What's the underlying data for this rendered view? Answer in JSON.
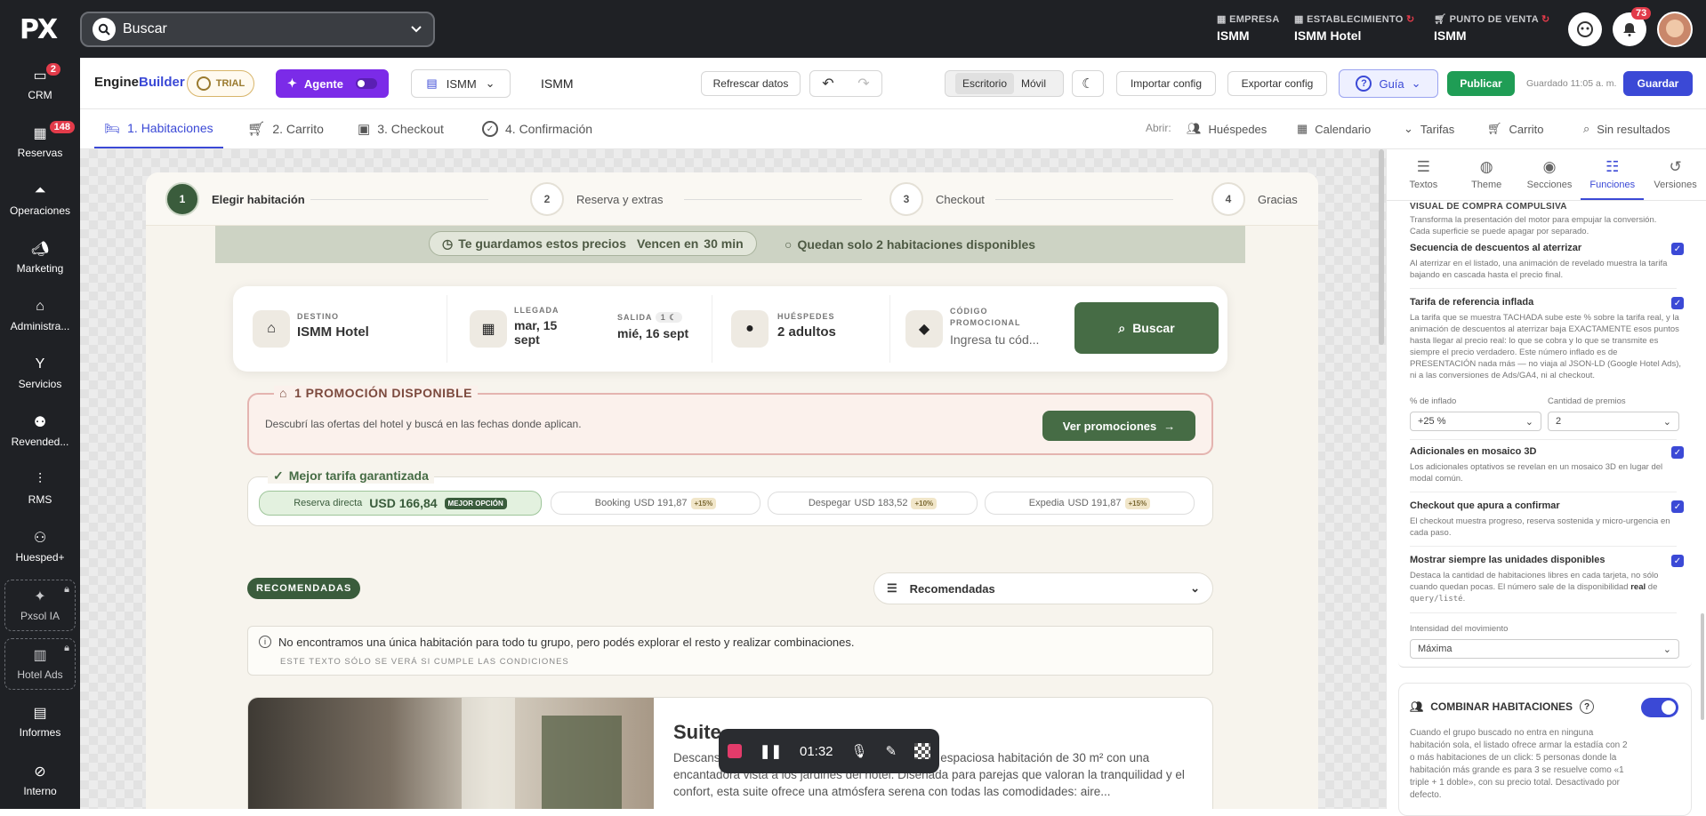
{
  "topbar": {
    "logo": "PX",
    "search_placeholder": "Buscar",
    "empresa_label": "EMPRESA",
    "empresa_value": "ISMM",
    "establecimiento_label": "ESTABLECIMIENTO",
    "establecimiento_value": "ISMM Hotel",
    "punto_venta_label": "PUNTO DE VENTA",
    "punto_venta_value": "ISMM",
    "notifications_count": "73"
  },
  "sidebar": {
    "items": [
      {
        "label": "CRM",
        "badge": "2",
        "icon": "chat-icon"
      },
      {
        "label": "Reservas",
        "badge": "148",
        "icon": "calendar-icon"
      },
      {
        "label": "Operaciones",
        "badge": "",
        "icon": "bell-icon"
      },
      {
        "label": "Marketing",
        "badge": "",
        "icon": "megaphone-icon"
      },
      {
        "label": "Administra...",
        "badge": "",
        "icon": "building-icon"
      },
      {
        "label": "Servicios",
        "badge": "",
        "icon": "cocktail-icon"
      },
      {
        "label": "Revended...",
        "badge": "",
        "icon": "people-icon"
      },
      {
        "label": "RMS",
        "badge": "",
        "icon": "chart-icon"
      },
      {
        "label": "Huesped+",
        "badge": "",
        "icon": "user-plus-icon"
      },
      {
        "label": "Pxsol IA",
        "badge": "",
        "icon": "sparkle-icon"
      },
      {
        "label": "Hotel Ads",
        "badge": "",
        "icon": "bar-chart-icon"
      },
      {
        "label": "Informes",
        "badge": "",
        "icon": "document-icon"
      },
      {
        "label": "Interno",
        "badge": "",
        "icon": "block-icon"
      }
    ]
  },
  "builder": {
    "brand_a": "Engine",
    "brand_b": "Builder",
    "trial": "TRIAL",
    "agent": "Agente",
    "property": "ISMM",
    "property_name": "ISMM",
    "refresh": "Refrescar datos",
    "view_desktop": "Escritorio",
    "view_mobile": "Móvil",
    "import": "Importar config",
    "export": "Exportar config",
    "guide": "Guía",
    "publish": "Publicar",
    "saved": "Guardado 11:05 a. m.",
    "save": "Guardar"
  },
  "tabs": [
    {
      "label": "1. Habitaciones"
    },
    {
      "label": "2. Carrito"
    },
    {
      "label": "3. Checkout"
    },
    {
      "label": "4. Confirmación"
    }
  ],
  "open_links": {
    "label": "Abrir:",
    "items": [
      "Huéspedes",
      "Calendario",
      "Tarifas",
      "Carrito",
      "Sin resultados"
    ]
  },
  "preview": {
    "steps": [
      {
        "num": "1",
        "label": "Elegir habitación"
      },
      {
        "num": "2",
        "label": "Reserva y extras"
      },
      {
        "num": "3",
        "label": "Checkout"
      },
      {
        "num": "4",
        "label": "Gracias"
      }
    ],
    "banner_a": "Te guardamos estos precios",
    "banner_b": "Vencen en",
    "banner_time": "30 min",
    "banner_c": "Quedan solo 2 habitaciones disponibles",
    "destino_label": "DESTINO",
    "destino_value": "ISMM Hotel",
    "llegada_label": "LLEGADA",
    "llegada_value": "mar, 15 sept",
    "salida_label": "SALIDA",
    "salida_nights": "1",
    "salida_value": "mié, 16 sept",
    "huespedes_label": "HUÉSPEDES",
    "huespedes_value": "2 adultos",
    "codigo_label": "CÓDIGO PROMOCIONAL",
    "codigo_placeholder": "Ingresa tu cód...",
    "search_btn": "Buscar",
    "promo_title": "1 PROMOCIÓN DISPONIBLE",
    "promo_desc": "Descubrí las ofertas del hotel y buscá en las fechas donde aplican.",
    "promo_btn": "Ver promociones",
    "best_rate_title": "Mejor tarifa garantizada",
    "direct_label": "Reserva directa",
    "direct_price": "USD 166,84",
    "direct_tag": "MEJOR OPCIÓN",
    "competitors": [
      {
        "name": "Booking",
        "price": "USD 191,87",
        "diff": "+15%"
      },
      {
        "name": "Despegar",
        "price": "USD 183,52",
        "diff": "+10%"
      },
      {
        "name": "Expedia",
        "price": "USD 191,87",
        "diff": "+15%"
      }
    ],
    "recommended_tag": "RECOMENDADAS",
    "sort_value": "Recomendadas",
    "notice_text": "No encontramos una única habitación para todo tu grupo, pero podés explorar el resto y realizar combinaciones.",
    "notice_sub": "ESTE TEXTO SÓLO SE VERÁ SI CUMPLE LAS CONDICIONES",
    "room_title": "Suite",
    "room_desc": "Descansa en nuestra elegante Suite Garden, una espaciosa habitación de 30 m² con una encantadora vista a los jardines del hotel. Diseñada para parejas que valoran la tranquilidad y el confort, esta suite ofrece una atmósfera serena con todas las comodidades: aire...",
    "recorder_time": "01:32"
  },
  "panel": {
    "tabs": [
      {
        "label": "Textos",
        "icon": "text-icon"
      },
      {
        "label": "Theme",
        "icon": "palette-icon"
      },
      {
        "label": "Secciones",
        "icon": "eye-icon"
      },
      {
        "label": "Funciones",
        "icon": "sliders-icon"
      },
      {
        "label": "Versiones",
        "icon": "history-icon"
      }
    ],
    "section_title": "VISUAL DE COMPRA COMPULSIVA",
    "section_desc": "Transforma la presentación del motor para empujar la conversión. Cada superficie se puede apagar por separado.",
    "options": [
      {
        "title": "Secuencia de descuentos al aterrizar",
        "desc": "Al aterrizar en el listado, una animación de revelado muestra la tarifa bajando en cascada hasta el precio final.",
        "checked": true
      },
      {
        "title": "Tarifa de referencia inflada",
        "desc": "La tarifa que se muestra TACHADA sube este % sobre la tarifa real, y la animación de descuentos al aterrizar baja EXACTAMENTE esos puntos hasta llegar al precio real: lo que se cobra y lo que se transmite es siempre el precio verdadero. Este número inflado es de PRESENTACIÓN nada más — no viaja al JSON-LD (Google Hotel Ads), ni a las conversiones de Ads/GA4, ni al checkout.",
        "checked": true
      },
      {
        "title": "Adicionales en mosaico 3D",
        "desc": "Los adicionales optativos se revelan en un mosaico 3D en lugar del modal común.",
        "checked": true
      },
      {
        "title": "Checkout que apura a confirmar",
        "desc": "El checkout muestra progreso, reserva sostenida y micro-urgencia en cada paso.",
        "checked": true
      },
      {
        "title": "Mostrar siempre las unidades disponibles",
        "desc_a": "Destaca la cantidad de habitaciones libres en cada tarjeta, no sólo cuando quedan pocas. El número sale de la disponibilidad",
        "desc_b": "real",
        "desc_c": "de",
        "desc_code": "query/listé",
        "desc_d": ".",
        "checked": true
      }
    ],
    "inflate_label": "% de inflado",
    "inflate_value": "+25 %",
    "prizes_label": "Cantidad de premios",
    "prizes_value": "2",
    "intensity_label": "Intensidad del movimiento",
    "intensity_value": "Máxima",
    "combine_title": "COMBINAR HABITACIONES",
    "combine_desc": "Cuando el grupo buscado no entra en ninguna habitación sola, el listado ofrece armar la estadía con 2 o más habitaciones de un click: 5 personas donde la habitación más grande es para 3 se resuelve como «1 triple + 1 doble», con su precio total. Desactivado por defecto."
  },
  "colors": {
    "accent": "#3b49d6",
    "brand_green": "#466c45",
    "publish": "#1f9d55",
    "agent": "#7b2be8",
    "dark": "#1f2125"
  }
}
